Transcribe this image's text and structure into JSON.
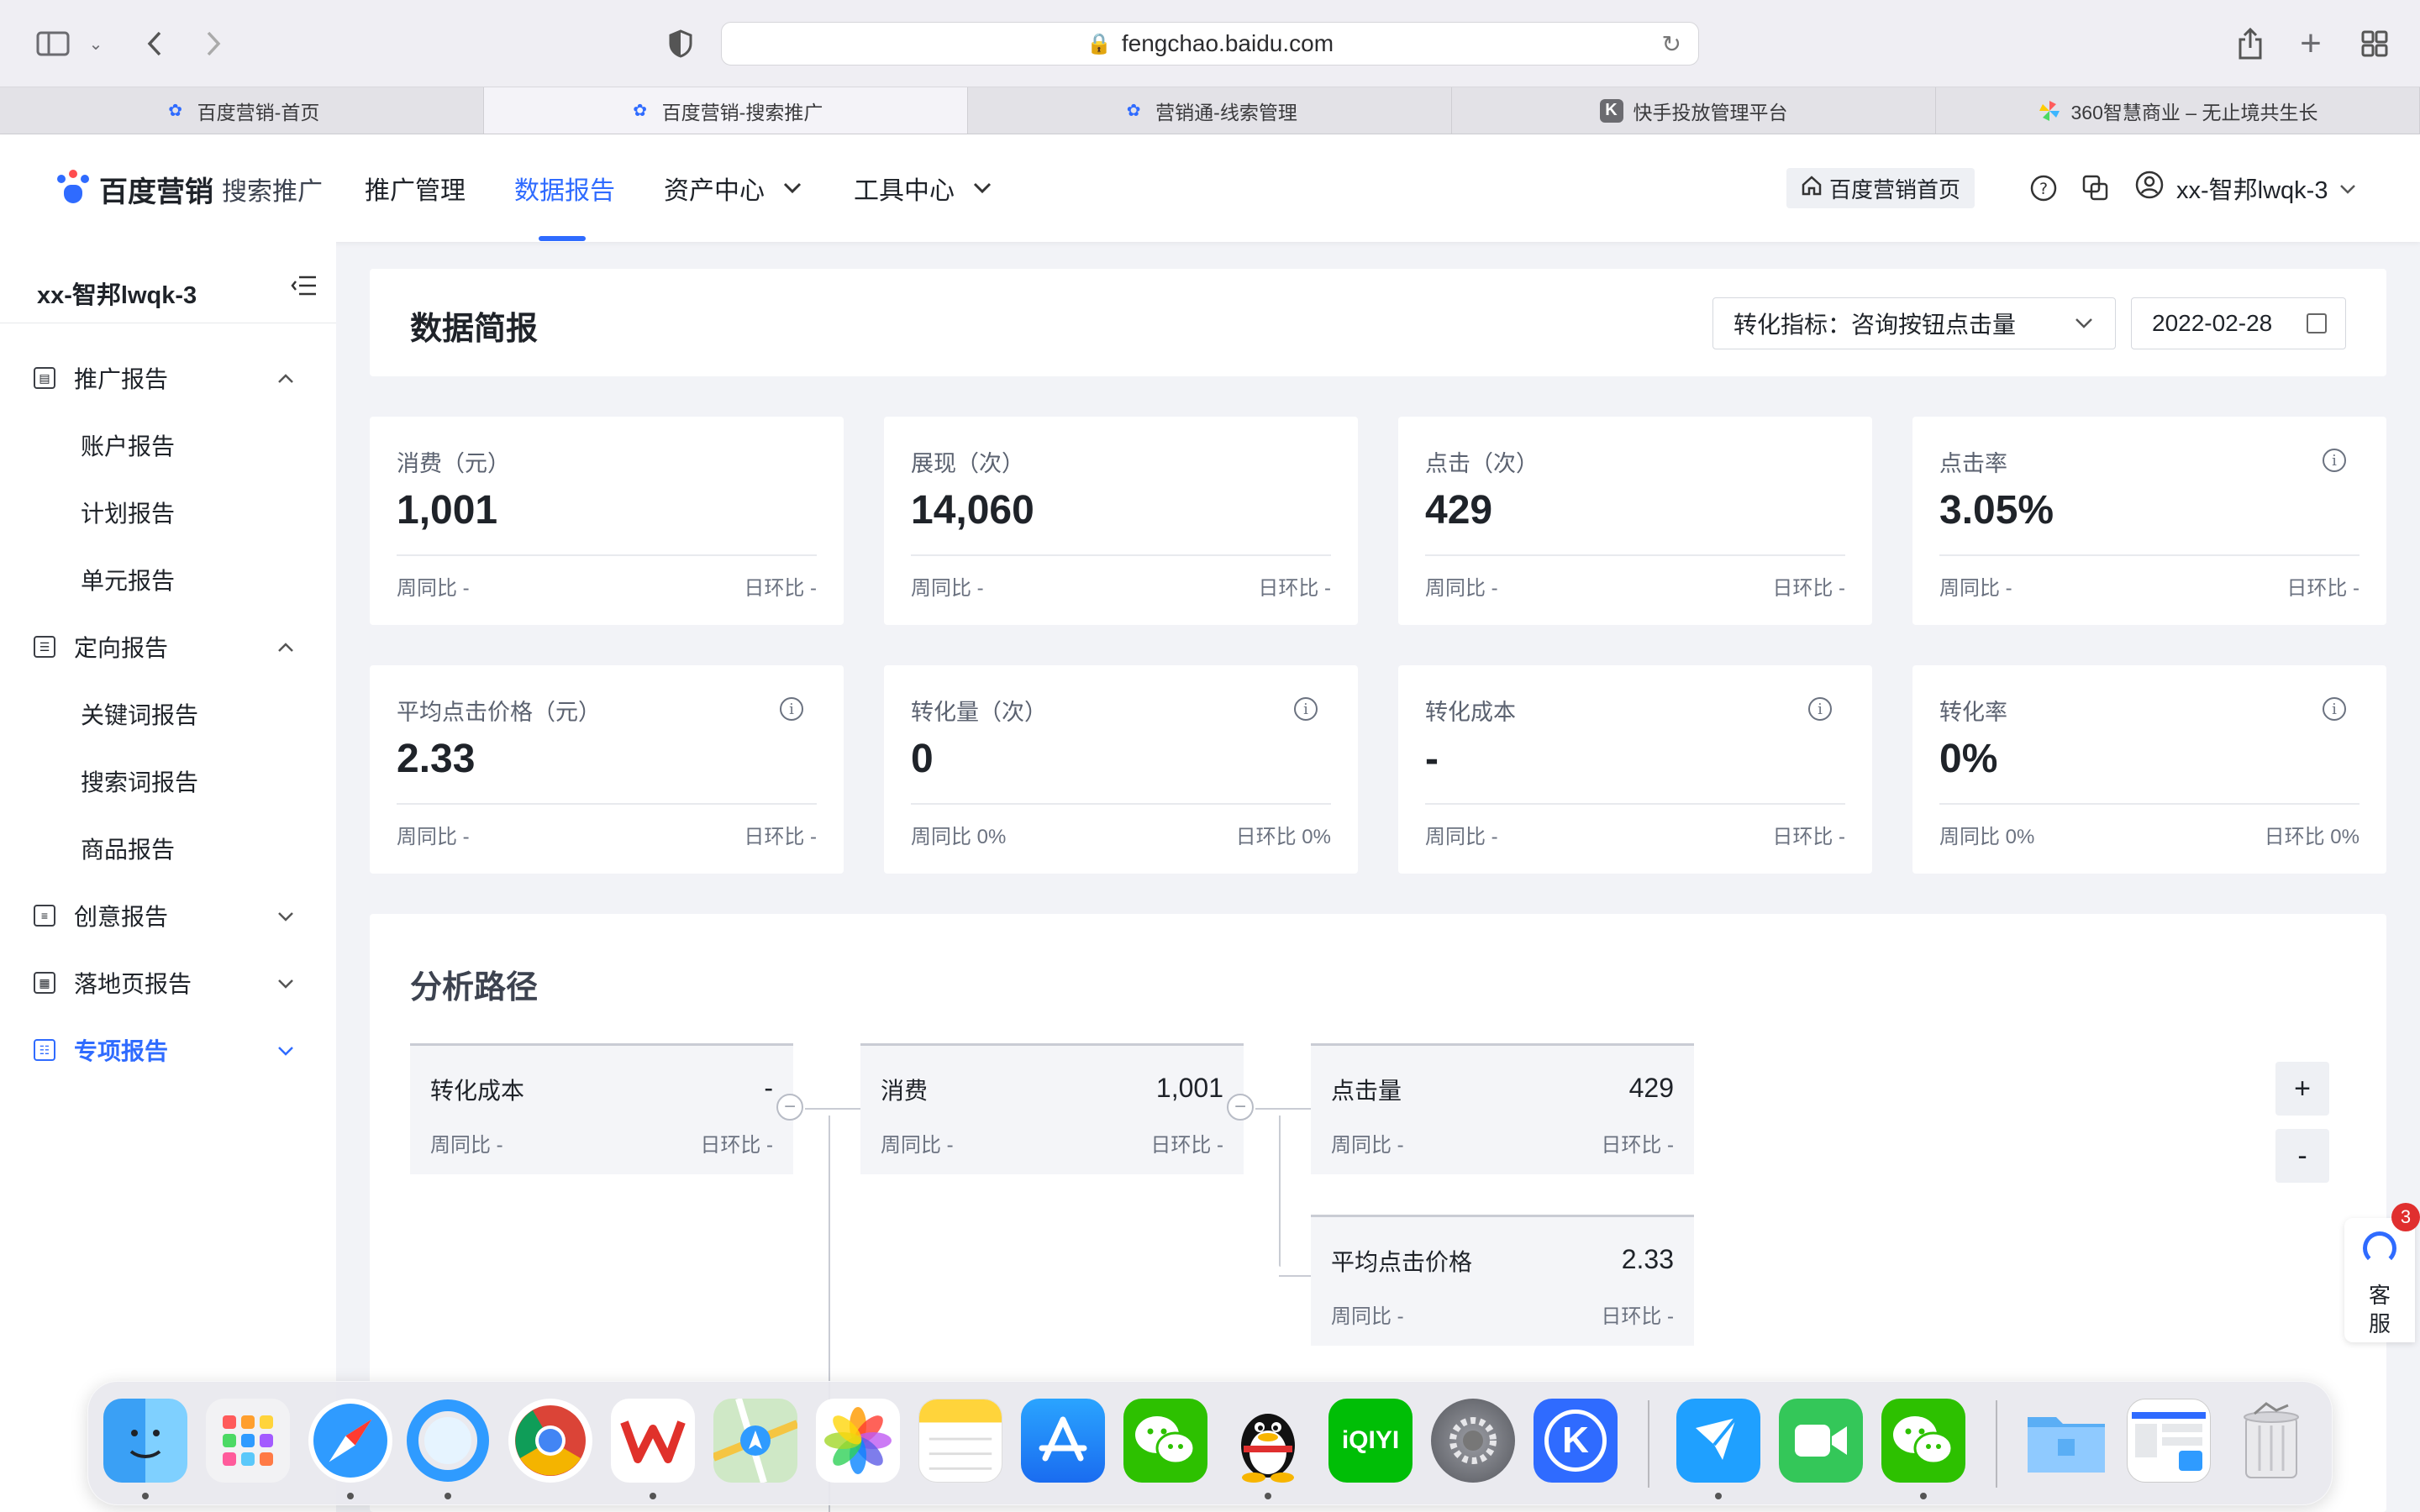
{
  "browser": {
    "url": "fengchao.baidu.com",
    "tabs": [
      {
        "label": "百度营销-首页",
        "fav": "baidu-paw-icon",
        "active": false
      },
      {
        "label": "百度营销-搜索推广",
        "fav": "baidu-paw-icon",
        "active": true
      },
      {
        "label": "营销通-线索管理",
        "fav": "baidu-paw-icon",
        "active": false
      },
      {
        "label": "快手投放管理平台",
        "fav": "k-icon",
        "fav_text": "K",
        "active": false
      },
      {
        "label": "360智慧商业 – 无止境共生长",
        "fav": "pinwheel-icon",
        "active": false
      }
    ]
  },
  "header": {
    "brand": "百度营销",
    "brand_sub": "搜索推广",
    "nav": [
      "推广管理",
      "数据报告",
      "资产中心",
      "工具中心"
    ],
    "active_nav": "数据报告",
    "home_button": "百度营销首页",
    "user": "xx-智邦lwqk-3"
  },
  "sidebar": {
    "account": "xx-智邦lwqk-3",
    "groups": [
      {
        "label": "推广报告",
        "expanded": true,
        "items": [
          "账户报告",
          "计划报告",
          "单元报告"
        ]
      },
      {
        "label": "定向报告",
        "expanded": true,
        "items": [
          "关键词报告",
          "搜索词报告",
          "商品报告"
        ]
      },
      {
        "label": "创意报告",
        "expanded": false,
        "items": []
      },
      {
        "label": "落地页报告",
        "expanded": false,
        "items": []
      },
      {
        "label": "专项报告",
        "expanded": false,
        "items": [],
        "highlight": true
      }
    ]
  },
  "overview": {
    "title": "数据简报",
    "metric_select": "转化指标：咨询按钮点击量",
    "date": "2022-02-28",
    "cards": [
      {
        "label": "消费（元）",
        "value": "1,001",
        "week": "周同比 -",
        "day": "日环比 -",
        "info": false
      },
      {
        "label": "展现（次）",
        "value": "14,060",
        "week": "周同比 -",
        "day": "日环比 -",
        "info": false
      },
      {
        "label": "点击（次）",
        "value": "429",
        "week": "周同比 -",
        "day": "日环比 -",
        "info": false
      },
      {
        "label": "点击率",
        "value": "3.05%",
        "week": "周同比 -",
        "day": "日环比 -",
        "info": true
      },
      {
        "label": "平均点击价格（元）",
        "value": "2.33",
        "week": "周同比 -",
        "day": "日环比 -",
        "info": true
      },
      {
        "label": "转化量（次）",
        "value": "0",
        "week": "周同比 0%",
        "day": "日环比 0%",
        "info": true
      },
      {
        "label": "转化成本",
        "value": "-",
        "week": "周同比 -",
        "day": "日环比 -",
        "info": true
      },
      {
        "label": "转化率",
        "value": "0%",
        "week": "周同比 0%",
        "day": "日环比 0%",
        "info": true
      }
    ]
  },
  "path": {
    "title": "分析路径",
    "nodes": [
      {
        "label": "转化成本",
        "value": "-",
        "week": "周同比 -",
        "day": "日环比 -"
      },
      {
        "label": "消费",
        "value": "1,001",
        "week": "周同比 -",
        "day": "日环比 -"
      },
      {
        "label": "点击量",
        "value": "429",
        "week": "周同比 -",
        "day": "日环比 -"
      },
      {
        "label": "平均点击价格",
        "value": "2.33",
        "week": "周同比 -",
        "day": "日环比 -"
      }
    ],
    "zoom_in": "+",
    "zoom_out": "-"
  },
  "service": {
    "line1": "客",
    "line2": "服",
    "badge": "3"
  },
  "dock": {
    "apps": [
      "finder-icon",
      "launchpad-icon",
      "safari-icon",
      "qq-browser-icon",
      "chrome-icon",
      "wps-icon",
      "maps-icon",
      "photos-icon",
      "notes-icon",
      "app-store-icon",
      "wechat-icon",
      "qq-icon",
      "iqiyi-icon",
      "system-preferences-icon",
      "kuaishou-k-icon",
      "feishu-icon",
      "facetime-icon",
      "wechat-icon",
      "downloads-folder-icon",
      "screenshot-stack-icon",
      "trash-icon"
    ],
    "iqiyi_text": "iQIYI",
    "k_text": "K"
  }
}
